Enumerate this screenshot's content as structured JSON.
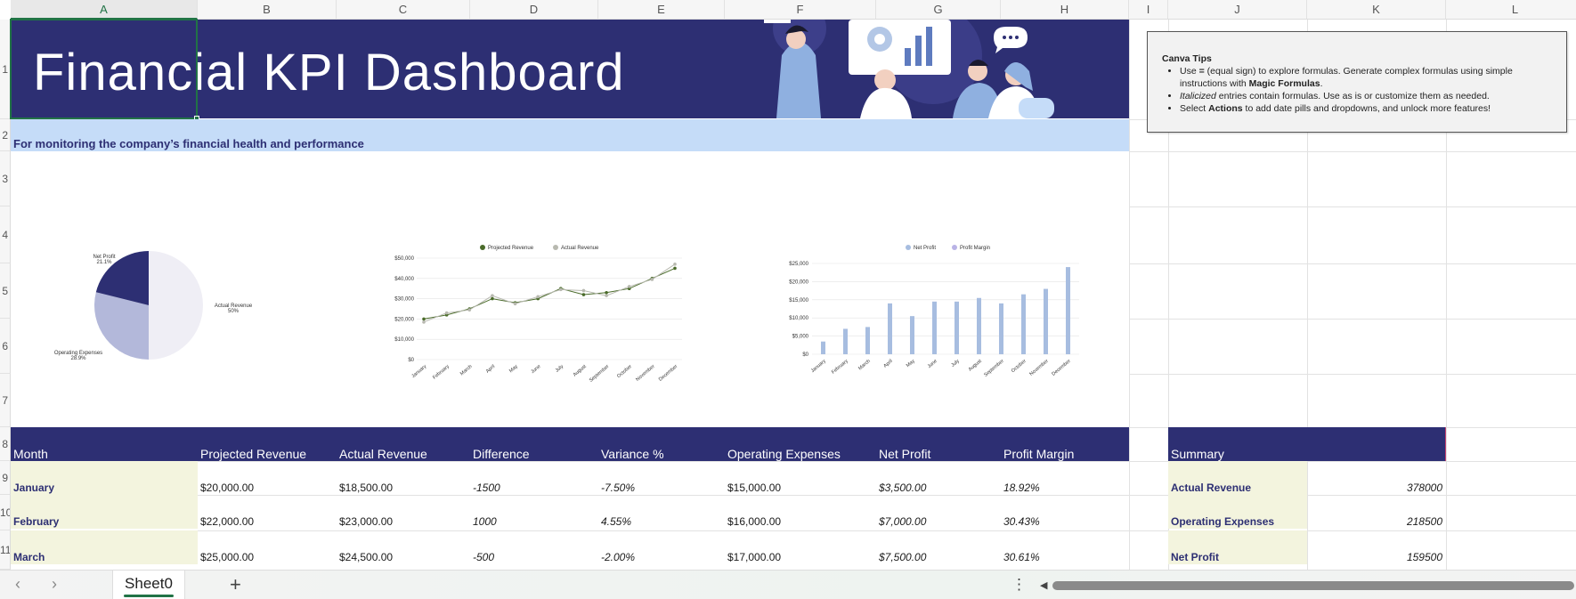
{
  "app": {
    "sheet_tab": "Sheet0"
  },
  "columns": [
    "A",
    "B",
    "C",
    "D",
    "E",
    "F",
    "G",
    "H",
    "I",
    "J",
    "K",
    "L"
  ],
  "rows": [
    "1",
    "2",
    "3",
    "4",
    "5",
    "6",
    "7",
    "8",
    "9",
    "10",
    "11"
  ],
  "title": "Financial KPI Dashboard",
  "subtitle": "For monitoring the company’s financial health and performance",
  "colors": {
    "navy": "#2d2f73",
    "light_blue": "#c5dcf8",
    "cream": "#f3f4de",
    "grid_green": "#217346",
    "pie_navy": "#2d2f73",
    "pie_lavender": "#b3b8da",
    "pie_white": "#efeef5",
    "line_dark": "#4a6b2a",
    "line_light": "#b8b9b0",
    "bar_blue": "#a7bde0"
  },
  "canva_tips": {
    "heading": "Canva Tips",
    "items": [
      {
        "pre": "Use ",
        "bold": "=",
        "post": " (equal sign) to explore formulas. Generate complex formulas using simple instructions with "
      },
      {
        "pre": "",
        "italic": "Italicized",
        "post": " entries contain formulas. Use as is or customize them as needed."
      },
      {
        "pre": "Select ",
        "bold": "Actions",
        "post": " to add date pills and dropdowns, and unlock more features!"
      }
    ],
    "magic": "Magic Formulas"
  },
  "table": {
    "headers": [
      "Month",
      "Projected Revenue",
      "Actual Revenue",
      "Difference",
      "Variance %",
      "Operating Expenses",
      "Net Profit",
      "Profit Margin"
    ],
    "rows": [
      [
        "January",
        "$20,000.00",
        "$18,500.00",
        "-1500",
        "-7.50%",
        "$15,000.00",
        "$3,500.00",
        "18.92%"
      ],
      [
        "February",
        "$22,000.00",
        "$23,000.00",
        "1000",
        "4.55%",
        "$16,000.00",
        "$7,000.00",
        "30.43%"
      ],
      [
        "March",
        "$25,000.00",
        "$24,500.00",
        "-500",
        "-2.00%",
        "$17,000.00",
        "$7,500.00",
        "30.61%"
      ]
    ]
  },
  "summary": {
    "header": "Summary",
    "rows": [
      {
        "label": "Actual Revenue",
        "value": "378000"
      },
      {
        "label": "Operating Expenses",
        "value": "218500"
      },
      {
        "label": "Net Profit",
        "value": "159500"
      }
    ]
  },
  "chart_data": [
    {
      "type": "pie",
      "slices": [
        {
          "label": "Actual Revenue",
          "pct_label": "50%",
          "value": 50
        },
        {
          "label": "Operating Expenses",
          "pct_label": "28.9%",
          "value": 28.9
        },
        {
          "label": "Net Profit",
          "pct_label": "21.1%",
          "value": 21.1
        }
      ]
    },
    {
      "type": "line",
      "categories": [
        "January",
        "February",
        "March",
        "April",
        "May",
        "June",
        "July",
        "August",
        "September",
        "October",
        "November",
        "December"
      ],
      "series": [
        {
          "name": "Projected Revenue",
          "values": [
            20000,
            22000,
            25000,
            30000,
            28000,
            30000,
            35000,
            32000,
            33000,
            35000,
            40000,
            45000
          ]
        },
        {
          "name": "Actual Revenue",
          "values": [
            18500,
            23000,
            24500,
            31500,
            27500,
            31000,
            34500,
            34000,
            31500,
            36000,
            39500,
            47000
          ]
        }
      ],
      "yticks": [
        "$0",
        "$10,000",
        "$20,000",
        "$30,000",
        "$40,000",
        "$50,000"
      ],
      "ylim": [
        0,
        50000
      ],
      "legend": "top",
      "grid": true
    },
    {
      "type": "bar",
      "categories": [
        "January",
        "February",
        "March",
        "April",
        "May",
        "June",
        "July",
        "August",
        "September",
        "October",
        "November",
        "December"
      ],
      "series": [
        {
          "name": "Net Profit",
          "values": [
            3500,
            7000,
            7500,
            14000,
            10500,
            14500,
            14500,
            15500,
            14000,
            16500,
            18000,
            24000
          ]
        }
      ],
      "legend_items": [
        "Net Profit",
        "Profit Margin"
      ],
      "yticks": [
        "$0",
        "$5,000",
        "$10,000",
        "$15,000",
        "$20,000",
        "$25,000"
      ],
      "ylim": [
        0,
        25000
      ],
      "legend": "top",
      "grid": true
    }
  ]
}
